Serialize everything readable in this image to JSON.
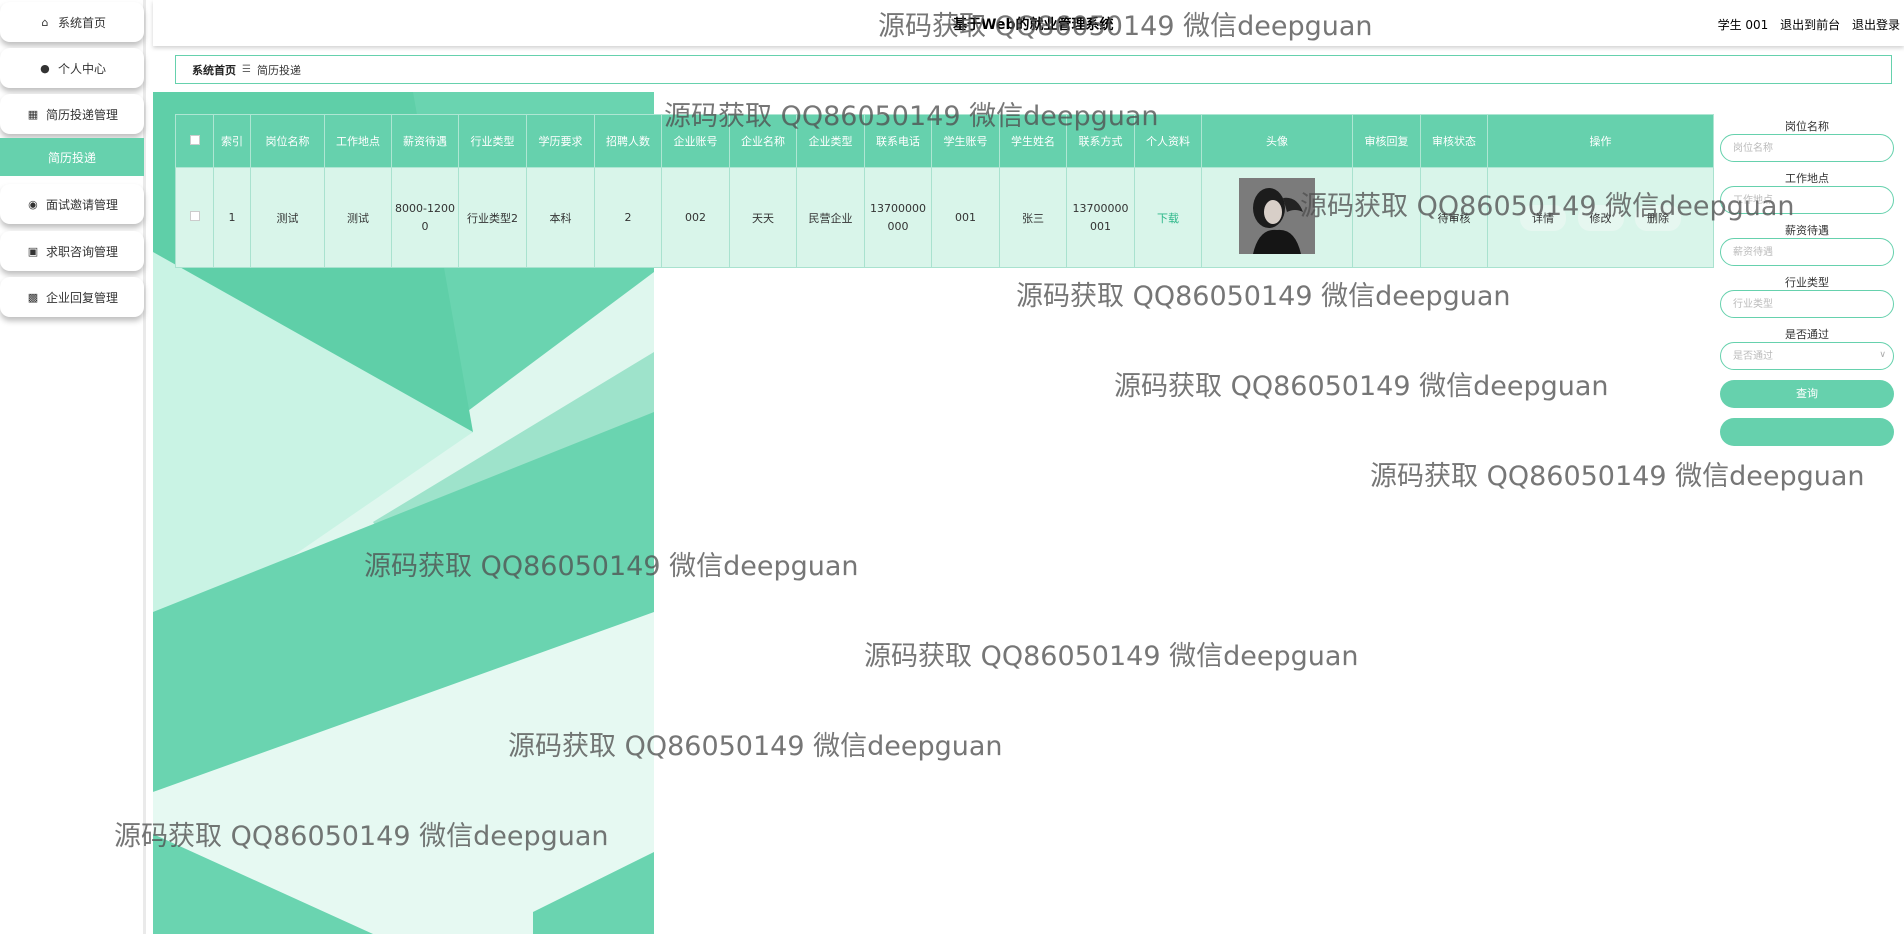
{
  "header": {
    "title": "基于Web的就业管理系统",
    "user": "学生 001",
    "back_front": "退出到前台",
    "logout": "退出登录"
  },
  "sidebar": {
    "items": [
      {
        "label": "系统首页",
        "icon": "home-icon"
      },
      {
        "label": "个人中心",
        "icon": "user-icon"
      },
      {
        "label": "简历投递管理",
        "icon": "grid-icon"
      },
      {
        "label": "简历投递",
        "icon": "none",
        "active": true
      },
      {
        "label": "面试邀请管理",
        "icon": "pin-icon"
      },
      {
        "label": "求职咨询管理",
        "icon": "apps-icon"
      },
      {
        "label": "企业回复管理",
        "icon": "building-icon"
      }
    ]
  },
  "breadcrumb": {
    "home": "系统首页",
    "current": "简历投递"
  },
  "table": {
    "headers": [
      "索引",
      "岗位名称",
      "工作地点",
      "薪资待遇",
      "行业类型",
      "学历要求",
      "招聘人数",
      "企业账号",
      "企业名称",
      "企业类型",
      "联系电话",
      "学生账号",
      "学生姓名",
      "联系方式",
      "个人资料",
      "头像",
      "审核回复",
      "审核状态",
      "操作"
    ],
    "rows": [
      {
        "index": "1",
        "position": "测试",
        "location": "测试",
        "salary": "8000-12000",
        "industry": "行业类型2",
        "education": "本科",
        "headcount": "2",
        "company_account": "002",
        "company_name": "天天",
        "company_type": "民营企业",
        "phone": "13700000000",
        "student_account": "001",
        "student_name": "张三",
        "contact": "13700000001",
        "resume": "下载",
        "review_reply": "",
        "review_status": "待审核",
        "actions": [
          "详情",
          "修改",
          "删除"
        ]
      }
    ]
  },
  "search": {
    "fields": [
      {
        "label": "岗位名称",
        "placeholder": "岗位名称"
      },
      {
        "label": "工作地点",
        "placeholder": "工作地点"
      },
      {
        "label": "薪资待遇",
        "placeholder": "薪资待遇"
      },
      {
        "label": "行业类型",
        "placeholder": "行业类型"
      }
    ],
    "select": {
      "label": "是否通过",
      "placeholder": "是否通过"
    },
    "query_button": "查询",
    "second_button": "",
    "accent": "#66d1ad"
  },
  "watermark": "源码获取 QQ86050149 微信deepguan"
}
